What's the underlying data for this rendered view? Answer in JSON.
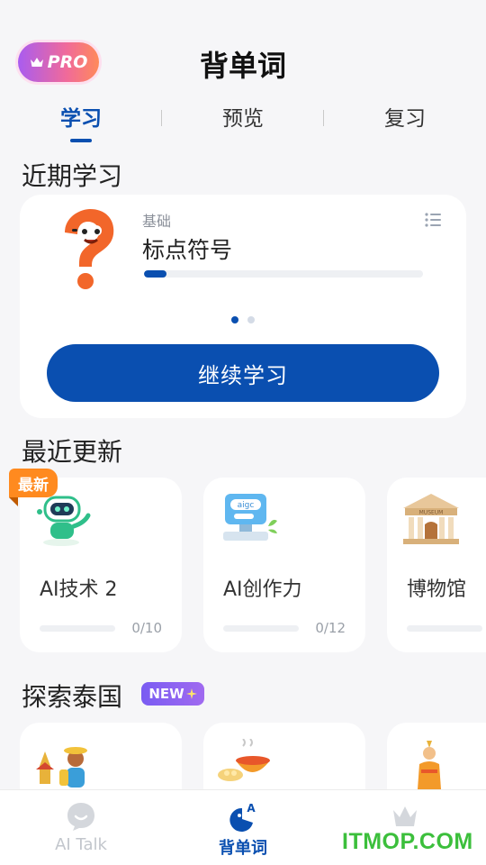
{
  "header": {
    "pro_label": "PRO",
    "title": "背单词"
  },
  "tabs": [
    {
      "label": "学习",
      "active": true
    },
    {
      "label": "预览",
      "active": false
    },
    {
      "label": "复习",
      "active": false
    }
  ],
  "recent_study": {
    "section_title": "近期学习",
    "course": {
      "category": "基础",
      "name": "标点符号",
      "progress": 0.08,
      "icon": "question-mark-mascot-icon"
    },
    "pager": {
      "total": 2,
      "active_index": 0
    },
    "continue_label": "继续学习"
  },
  "recent_updates": {
    "section_title": "最近更新",
    "new_badge": "最新",
    "items": [
      {
        "name": "AI技术 2",
        "count": "0/10",
        "icon": "robot-icon"
      },
      {
        "name": "AI创作力",
        "count": "0/12",
        "icon": "aigc-computer-icon"
      },
      {
        "name": "博物馆",
        "count": "",
        "icon": "museum-icon"
      }
    ]
  },
  "explore": {
    "section_title": "探索泰国",
    "new_label": "NEW",
    "items": [
      {
        "icon": "thai-traveler-icon"
      },
      {
        "icon": "thai-food-icon"
      },
      {
        "icon": "thai-dancer-icon"
      }
    ]
  },
  "bottom_nav": [
    {
      "label": "AI Talk",
      "icon": "chat-bubble-icon",
      "active": false
    },
    {
      "label": "背单词",
      "icon": "vocab-icon",
      "active": true
    },
    {
      "label": "",
      "icon": "crown-icon",
      "active": false
    }
  ],
  "watermark": "ITMOP.COM",
  "colors": {
    "primary": "#0a4fb0",
    "accent_orange": "#ff8a1f",
    "new_purple": "#7a5cf2",
    "watermark_green": "#3cbf3c"
  }
}
